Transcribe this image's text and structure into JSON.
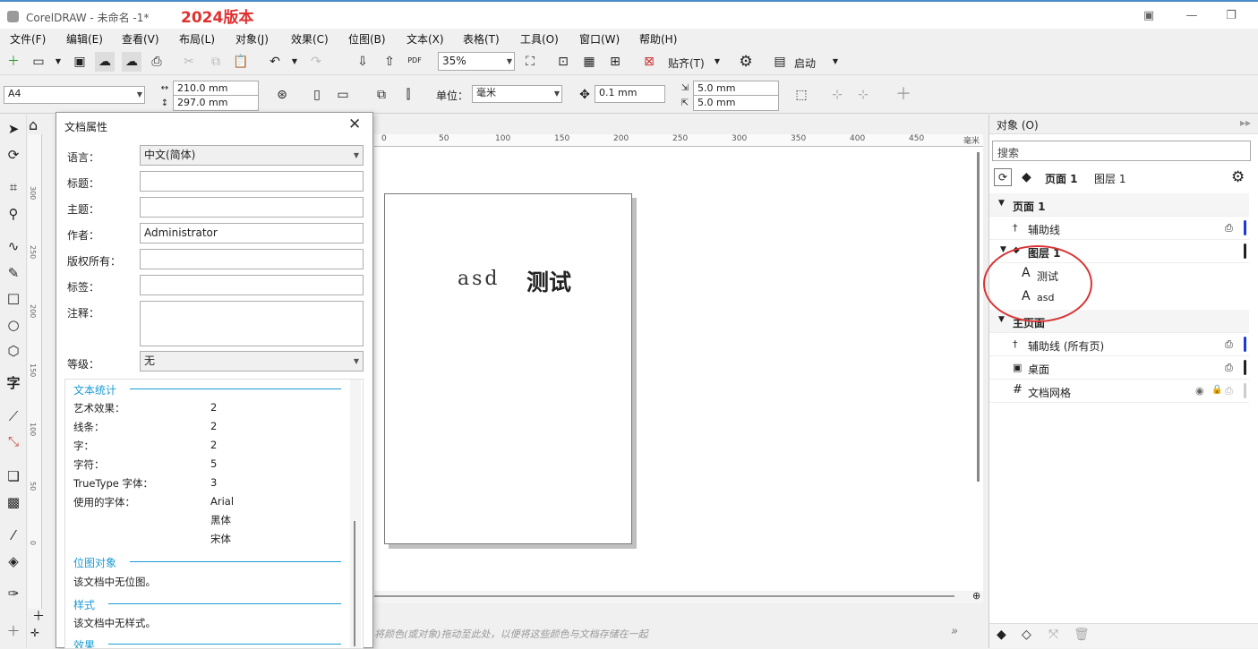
{
  "window": {
    "title": "CorelDRAW - 未命名 -1*",
    "tag": "2024版本"
  },
  "menu": [
    "文件(F)",
    "编辑(E)",
    "查看(V)",
    "布局(L)",
    "对象(J)",
    "效果(C)",
    "位图(B)",
    "文本(X)",
    "表格(T)",
    "工具(O)",
    "窗口(W)",
    "帮助(H)"
  ],
  "toolbar": {
    "zoom": "35%",
    "snap": "贴齐(T)",
    "launch": "启动",
    "pdf": "PDF"
  },
  "propbar": {
    "page_size": "A4",
    "width": "210.0 mm",
    "height": "297.0 mm",
    "unit_label": "单位：",
    "unit": "毫米",
    "nudge": "0.1 mm",
    "dup_x": "5.0 mm",
    "dup_y": "5.0 mm"
  },
  "ruler": {
    "ticks": [
      "0",
      "50",
      "100",
      "150",
      "200",
      "250",
      "300",
      "350",
      "400",
      "450"
    ],
    "unit": "毫米",
    "vticks": [
      "300",
      "250",
      "200",
      "150",
      "100",
      "50",
      "0"
    ]
  },
  "page": {
    "text1": "asd",
    "text2": "测试"
  },
  "dialog": {
    "title": "文档属性",
    "fields": [
      {
        "label": "语言：",
        "value": "中文(简体)"
      },
      {
        "label": "标题：",
        "value": ""
      },
      {
        "label": "主题：",
        "value": ""
      },
      {
        "label": "作者：",
        "value": "Administrator"
      },
      {
        "label": "版权所有：",
        "value": ""
      },
      {
        "label": "标签：",
        "value": ""
      },
      {
        "label": "注释：",
        "value": ""
      },
      {
        "label": "等级：",
        "value": "无"
      }
    ],
    "text_stats": {
      "heading": "文本统计",
      "rows": [
        {
          "k": "艺术效果：",
          "v": "2"
        },
        {
          "k": "线条：",
          "v": "2"
        },
        {
          "k": "字：",
          "v": "2"
        },
        {
          "k": "字符：",
          "v": "5"
        },
        {
          "k": "TrueType 字体：",
          "v": "3"
        },
        {
          "k": "使用的字体：",
          "v": "Arial"
        }
      ],
      "fonts_extra": [
        "黑体",
        "宋体"
      ]
    },
    "bitmap": {
      "heading": "位图对象",
      "text": "该文档中无位图。"
    },
    "styles": {
      "heading": "样式",
      "text": "该文档中无样式。"
    },
    "effects": {
      "heading": "效果"
    }
  },
  "objects_panel": {
    "title": "对象 (O)",
    "search_placeholder": "搜索",
    "page_tab": "页面 1",
    "layer_tab": "图层 1",
    "page": "页面 1",
    "guides": "辅助线",
    "layer": "图层 1",
    "obj1": "测试",
    "obj2": "asd",
    "master": "主页面",
    "master_guides": "辅助线 (所有页)",
    "desktop": "桌面",
    "grid": "文档网格"
  },
  "status": {
    "hint": "将颜色(或对象)拖动至此处，以便将这些颜色与文档存储在一起"
  },
  "colors": {
    "accent": "#1a9cd6",
    "red": "#e03030",
    "blue_bar": "#1a3ad8"
  }
}
